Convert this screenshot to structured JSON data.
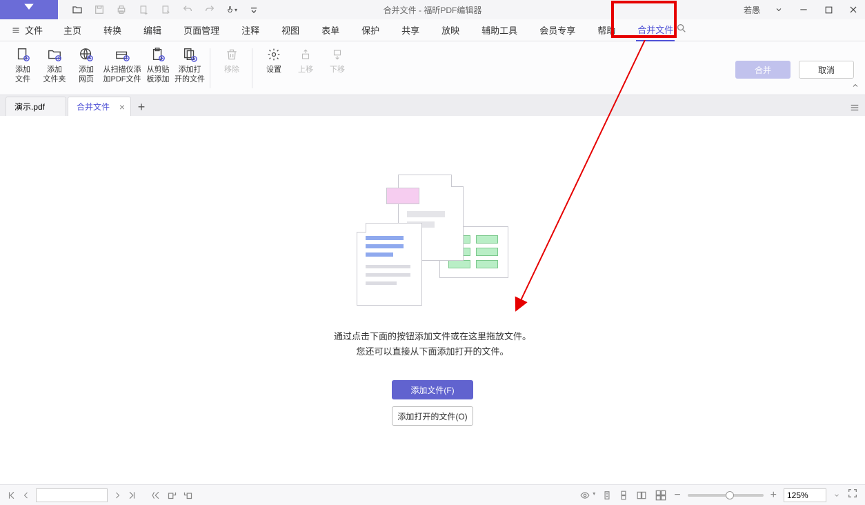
{
  "titlebar": {
    "title": "合并文件 - 福昕PDF编辑器",
    "username": "若愚"
  },
  "menu": {
    "file": "文件",
    "items": [
      "主页",
      "转换",
      "编辑",
      "页面管理",
      "注释",
      "视图",
      "表单",
      "保护",
      "共享",
      "放映",
      "辅助工具",
      "会员专享",
      "帮助",
      "合并文件"
    ],
    "active_index": 13
  },
  "ribbon": {
    "items": [
      {
        "label": "添加\n文件",
        "disabled": false
      },
      {
        "label": "添加\n文件夹",
        "disabled": false
      },
      {
        "label": "添加\n网页",
        "disabled": false
      },
      {
        "label": "从扫描仪添\n加PDF文件",
        "disabled": false,
        "wide": true
      },
      {
        "label": "从剪贴\n板添加",
        "disabled": false
      },
      {
        "label": "添加打\n开的文件",
        "disabled": false
      }
    ],
    "items2": [
      {
        "label": "移除",
        "disabled": true
      }
    ],
    "items3": [
      {
        "label": "设置",
        "disabled": false
      },
      {
        "label": "上移",
        "disabled": true
      },
      {
        "label": "下移",
        "disabled": true
      }
    ],
    "mergeBtn": "合并",
    "cancelBtn": "取消"
  },
  "tabs": {
    "list": [
      {
        "label": "演示.pdf",
        "active": false
      },
      {
        "label": "合并文件",
        "active": true
      }
    ]
  },
  "main": {
    "hint1": "通过点击下面的按钮添加文件或在这里拖放文件。",
    "hint2": "您还可以直接从下面添加打开的文件。",
    "addFiles": "添加文件(F)",
    "addOpenFiles": "添加打开的文件(O)"
  },
  "status": {
    "zoom": "125%"
  }
}
